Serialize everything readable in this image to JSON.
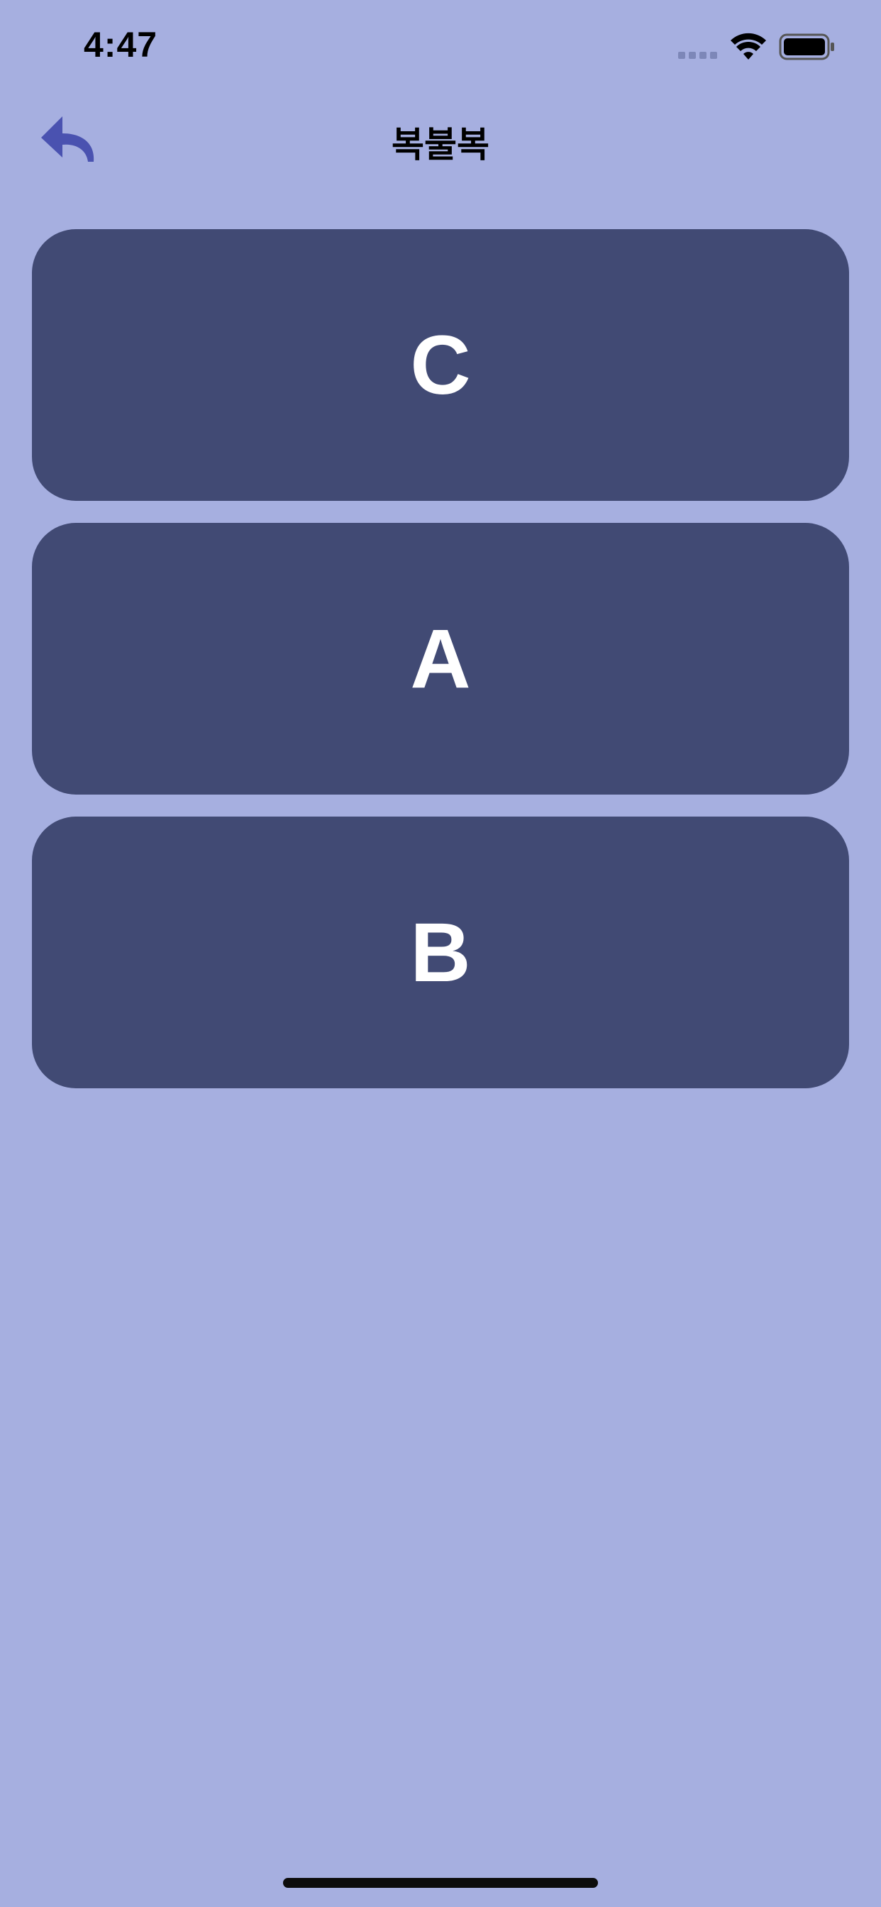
{
  "status_bar": {
    "time": "4:47",
    "icons": [
      "signal-dots-icon",
      "wifi-icon",
      "battery-icon"
    ]
  },
  "nav": {
    "title": "복불복",
    "back_icon": "back-arrow-icon",
    "accent_color": "#4a52b0"
  },
  "options": [
    {
      "label": "C"
    },
    {
      "label": "A"
    },
    {
      "label": "B"
    }
  ],
  "colors": {
    "background": "#a6afe0",
    "card": "#414a74",
    "card_text": "#ffffff"
  }
}
